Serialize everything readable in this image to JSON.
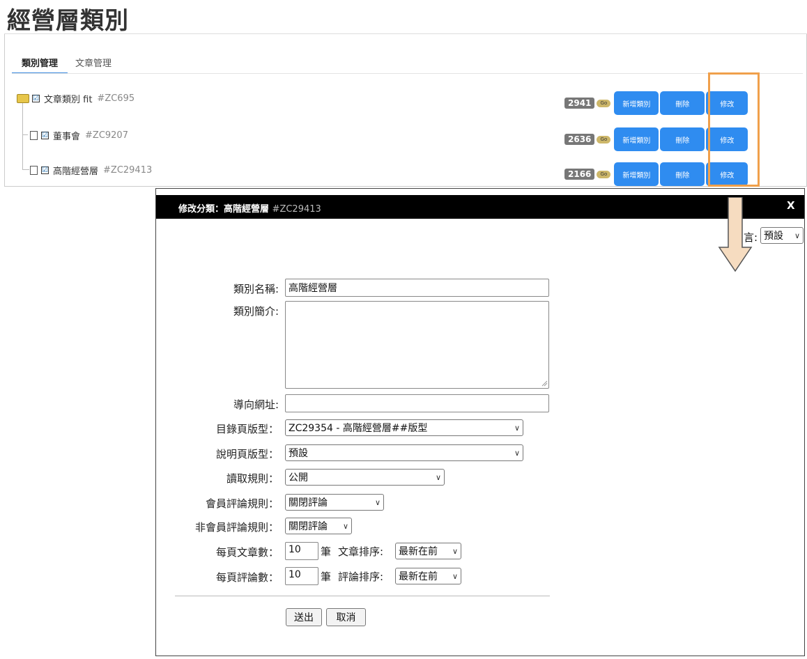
{
  "page": {
    "title": "經營層類別"
  },
  "tabs": {
    "category": "類別管理",
    "article": "文章管理"
  },
  "tree": [
    {
      "name": "文章類別 fit",
      "code": "#ZC695",
      "count": "2941"
    },
    {
      "name": "董事會",
      "code": "#ZC9207",
      "count": "2636"
    },
    {
      "name": "高階經營層",
      "code": "#ZC29413",
      "count": "2166"
    }
  ],
  "row_actions": {
    "go": "Go",
    "add": "新增類別",
    "delete": "刪除",
    "edit": "修改",
    "check": "☑"
  },
  "dialog": {
    "title": "修改分類：高階經營層",
    "title_code": "#ZC29413",
    "close": "X",
    "language_label": "言:",
    "language_value": "預設",
    "fields": {
      "name_label": "類別名稱:",
      "name_value": "高階經營層",
      "intro_label": "類別簡介:",
      "intro_value": "",
      "redirect_label": "導向網址:",
      "redirect_value": "",
      "list_tpl_label": "目錄頁版型：",
      "list_tpl_value": "ZC29354 - 高階經營層##版型",
      "desc_tpl_label": "說明頁版型：",
      "desc_tpl_value": "預設",
      "read_label": "讀取規則：",
      "read_value": "公開",
      "member_label": "會員評論規則：",
      "member_value": "關閉評論",
      "guest_label": "非會員評論規則：",
      "guest_value": "關閉評論",
      "per_page_label": "每頁文章數：",
      "per_page_value": "10",
      "per_page_unit": "筆",
      "article_sort_label": "文章排序:",
      "article_sort_value": "最新在前",
      "comments_label": "每頁評論數：",
      "comments_value": "10",
      "comments_unit": "筆",
      "comment_sort_label": "評論排序:",
      "comment_sort_value": "最新在前"
    },
    "submit": "送出",
    "cancel": "取消"
  },
  "colors": {
    "accent_blue": "#2f8cf0",
    "highlight_orange": "#f0a04b",
    "header_black": "#000000"
  }
}
